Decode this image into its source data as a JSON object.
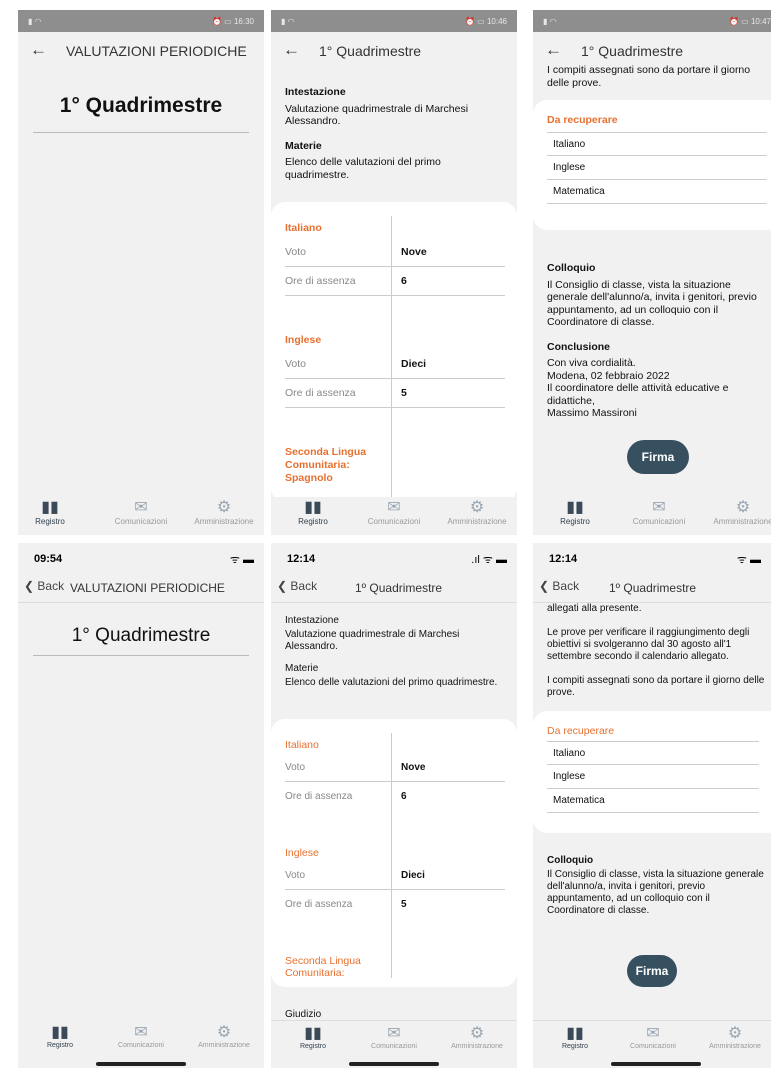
{
  "tabs": [
    {
      "label": "Registro",
      "icon": "book-icon"
    },
    {
      "label": "Comunicazioni",
      "icon": "envelope-icon"
    },
    {
      "label": "Amministrazione",
      "icon": "gear-icon"
    }
  ],
  "s1": {
    "status_time": "16:30",
    "header_title": "VALUTAZIONI PERIODICHE",
    "big_title": "1° Quadrimestre"
  },
  "s2": {
    "status_time": "10:46",
    "header_title": "1° Quadrimestre",
    "intestazione_label": "Intestazione",
    "intestazione_text": "Valutazione quadrimestrale di Marchesi Alessandro.",
    "materie_label": "Materie",
    "materie_text": "Elenco delle valutazioni del primo quadrimestre.",
    "subjects": [
      {
        "name": "Italiano",
        "voto_label": "Voto",
        "voto": "Nove",
        "assenze_label": "Ore di assenza",
        "assenze": "6"
      },
      {
        "name": "Inglese",
        "voto_label": "Voto",
        "voto": "Dieci",
        "assenze_label": "Ore di assenza",
        "assenze": "5"
      }
    ],
    "third_subject": "Seconda Lingua Comunitaria: Spagnolo"
  },
  "s3": {
    "status_time": "10:47",
    "header_title": "1° Quadrimestre",
    "top_text": "I compiti assegnati sono da portare il giorno delle prove.",
    "recover_title": "Da recuperare",
    "recover_items": [
      "Italiano",
      "Inglese",
      "Matematica"
    ],
    "colloquio_label": "Colloquio",
    "colloquio_text": "Il Consiglio di classe, vista la situazione generale dell'alunno/a, invita i genitori, previo appuntamento, ad un colloquio con il Coordinatore di classe.",
    "conclusione_label": "Conclusione",
    "conclusione_lines": [
      "Con viva cordialità.",
      "Modena, 02 febbraio 2022",
      "Il coordinatore delle attività educative e didattiche,",
      "Massimo Massironi"
    ],
    "sign_label": "Firma"
  },
  "s4": {
    "status_time": "09:54",
    "back_label": "Back",
    "header_title": "VALUTAZIONI PERIODICHE",
    "big_title": "1° Quadrimestre"
  },
  "s5": {
    "status_time": "12:14",
    "back_label": "Back",
    "header_title": "1º Quadrimestre",
    "intestazione_label": "Intestazione",
    "intestazione_text": "Valutazione quadrimestrale di Marchesi Alessandro.",
    "materie_label": "Materie",
    "materie_text": "Elenco delle valutazioni del primo quadrimestre.",
    "subjects": [
      {
        "name": "Italiano",
        "voto_label": "Voto",
        "voto": "Nove",
        "assenze_label": "Ore di assenza",
        "assenze": "6"
      },
      {
        "name": "Inglese",
        "voto_label": "Voto",
        "voto": "Dieci",
        "assenze_label": "Ore di assenza",
        "assenze": "5"
      }
    ],
    "third_subject": "Seconda Lingua Comunitaria:",
    "giudizio_label": "Giudizio"
  },
  "s6": {
    "status_time": "12:14",
    "back_label": "Back",
    "header_title": "1º Quadrimestre",
    "text1": "allegati alla presente.",
    "text2": "Le prove per verificare il raggiungimento degli obiettivi si svolgeranno dal 30 agosto all'1 settembre secondo il calendario allegato.",
    "text3": "I compiti assegnati sono da portare il giorno delle prove.",
    "recover_title": "Da recuperare",
    "recover_items": [
      "Italiano",
      "Inglese",
      "Matematica"
    ],
    "colloquio_label": "Colloquio",
    "colloquio_text": "Il Consiglio di classe, vista la situazione generale dell'alunno/a, invita i genitori, previo appuntamento, ad un colloquio con il Coordinatore di classe.",
    "sign_label": "Firma"
  }
}
